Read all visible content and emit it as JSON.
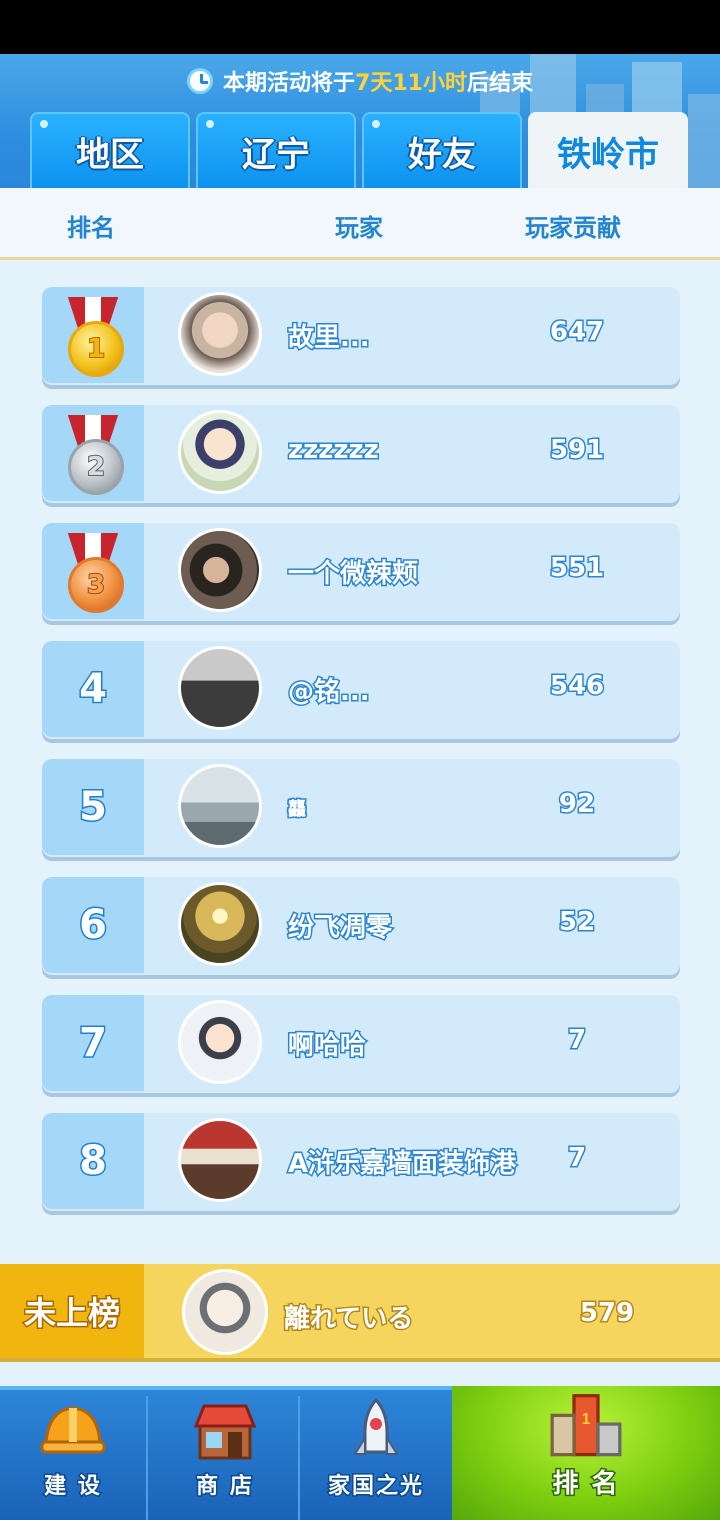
{
  "header": {
    "notice_prefix": "本期活动将于",
    "notice_highlight": "7天11小时",
    "notice_suffix": "后结束",
    "tabs": [
      {
        "label": "地区",
        "active": false
      },
      {
        "label": "辽宁",
        "active": false
      },
      {
        "label": "好友",
        "active": false
      },
      {
        "label": "铁岭市",
        "active": true
      }
    ]
  },
  "columns": {
    "rank": "排名",
    "player": "玩家",
    "contribution": "玩家贡献"
  },
  "rows": [
    {
      "rank": "1",
      "medal": "gold",
      "name": "故里...",
      "score": "647"
    },
    {
      "rank": "2",
      "medal": "silver",
      "name": "zzzzzz",
      "score": "591"
    },
    {
      "rank": "3",
      "medal": "bronze",
      "name": "一个微辣颊",
      "score": "551"
    },
    {
      "rank": "4",
      "name": "@铭...",
      "score": "546"
    },
    {
      "rank": "5",
      "name": "龘",
      "score": "92"
    },
    {
      "rank": "6",
      "name": "纷飞凋零",
      "score": "52"
    },
    {
      "rank": "7",
      "name": "啊哈哈",
      "score": "7"
    },
    {
      "rank": "8",
      "name": "A浒乐嘉墙面装饰港",
      "score": "7"
    }
  ],
  "self": {
    "rank_label": "未上榜",
    "name": "離れている",
    "score": "579"
  },
  "nav": [
    {
      "label": "建 设",
      "icon": "hard-hat-icon",
      "active": false
    },
    {
      "label": "商 店",
      "icon": "shop-icon",
      "active": false
    },
    {
      "label": "家国之光",
      "icon": "rocket-icon",
      "active": false
    },
    {
      "label": "排 名",
      "icon": "podium-icon",
      "active": true
    }
  ],
  "colors": {
    "accent": "#1c8de3",
    "highlight": "#ffd23a",
    "self_bar": "#f6d55f",
    "active_nav": "#7fcf10"
  }
}
